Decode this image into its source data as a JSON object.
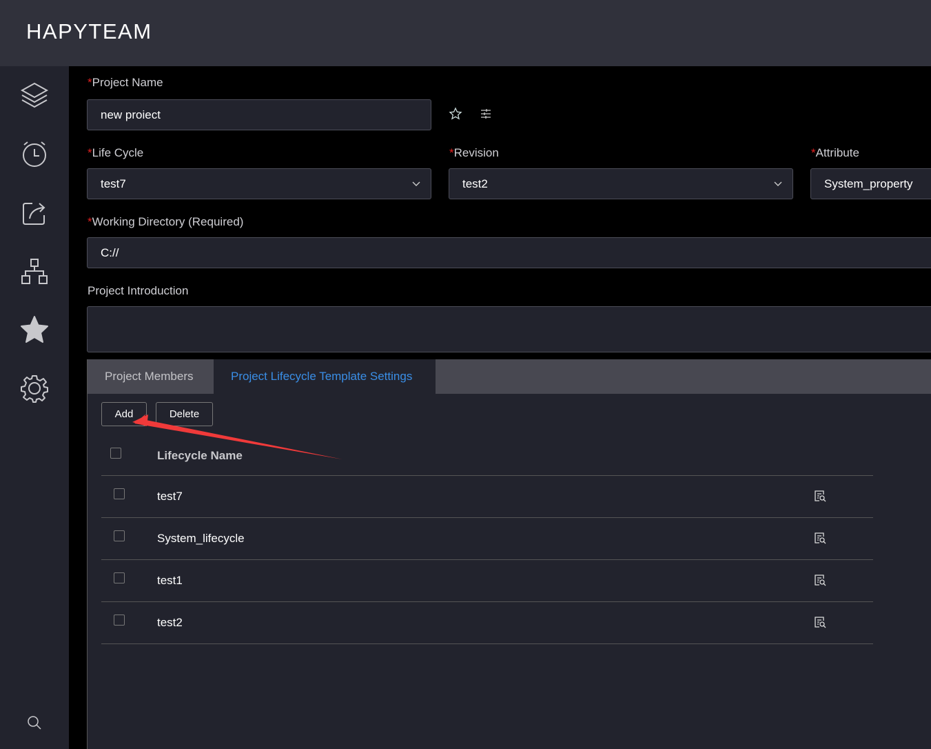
{
  "app": {
    "title": "HAPYTEAM"
  },
  "sidebar": {
    "items": [
      {
        "icon": "layers-icon"
      },
      {
        "icon": "alarm-clock-icon"
      },
      {
        "icon": "share-icon"
      },
      {
        "icon": "org-chart-icon"
      },
      {
        "icon": "star-icon"
      },
      {
        "icon": "gear-icon"
      },
      {
        "icon": "search-icon"
      }
    ]
  },
  "form": {
    "project_name": {
      "label": "Project Name",
      "value": "new proiect"
    },
    "life_cycle": {
      "label": "Life Cycle",
      "value": "test7"
    },
    "revision": {
      "label": "Revision",
      "value": "test2"
    },
    "attribute": {
      "label": "Attribute",
      "value": "System_property"
    },
    "working_directory": {
      "label": "Working Directory (Required)",
      "value": "C://"
    },
    "introduction": {
      "label": "Project Introduction",
      "value": ""
    },
    "required_mark": "*"
  },
  "tabs": [
    {
      "label": "Project Members",
      "active": false
    },
    {
      "label": "Project Lifecycle Template Settings",
      "active": true
    }
  ],
  "toolbar": {
    "add": "Add",
    "delete": "Delete"
  },
  "table": {
    "header": "Lifecycle Name",
    "rows": [
      {
        "name": "test7"
      },
      {
        "name": "System_lifecycle"
      },
      {
        "name": "test1"
      },
      {
        "name": "test2"
      }
    ]
  },
  "colors": {
    "accent": "#3a8ee6",
    "required": "#e02020",
    "annotation_arrow": "#f03a3a"
  }
}
